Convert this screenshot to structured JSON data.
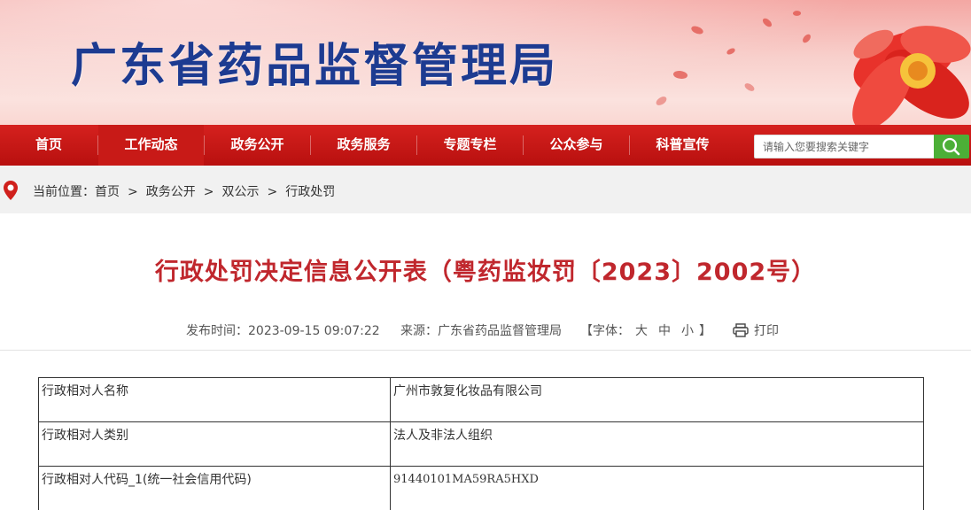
{
  "header": {
    "site_title": "广东省药品监督管理局"
  },
  "nav": {
    "items": [
      {
        "label": "首页"
      },
      {
        "label": "工作动态"
      },
      {
        "label": "政务公开"
      },
      {
        "label": "政务服务"
      },
      {
        "label": "专题专栏"
      },
      {
        "label": "公众参与"
      },
      {
        "label": "科普宣传"
      }
    ],
    "active_index": 1,
    "search_placeholder": "请输入您要搜索关键字"
  },
  "breadcrumb": {
    "prefix": "当前位置：",
    "items": [
      "首页",
      "政务公开",
      "双公示",
      "行政处罚"
    ],
    "separator": ">"
  },
  "article": {
    "title": "行政处罚决定信息公开表（粤药监妆罚〔2023〕2002号）",
    "publish_time": "发布时间：2023-09-15 09:07:22",
    "source": "来源：广东省药品监督管理局",
    "font_label_open": "【字体：",
    "font_large": "大",
    "font_medium": "中",
    "font_small": "小",
    "font_label_close": "】",
    "print_label": "打印"
  },
  "table": {
    "rows": [
      {
        "key": "行政相对人名称",
        "value": "广州市敦复化妆品有限公司"
      },
      {
        "key": "行政相对人类别",
        "value": "法人及非法人组织"
      },
      {
        "key": "行政相对人代码_1(统一社会信用代码)",
        "value": "91440101MA59RA5HXD"
      }
    ]
  },
  "colors": {
    "brand_red": "#c81a17",
    "title_red": "#c0272d",
    "title_blue": "#1d3b91",
    "search_green": "#4caf37"
  }
}
